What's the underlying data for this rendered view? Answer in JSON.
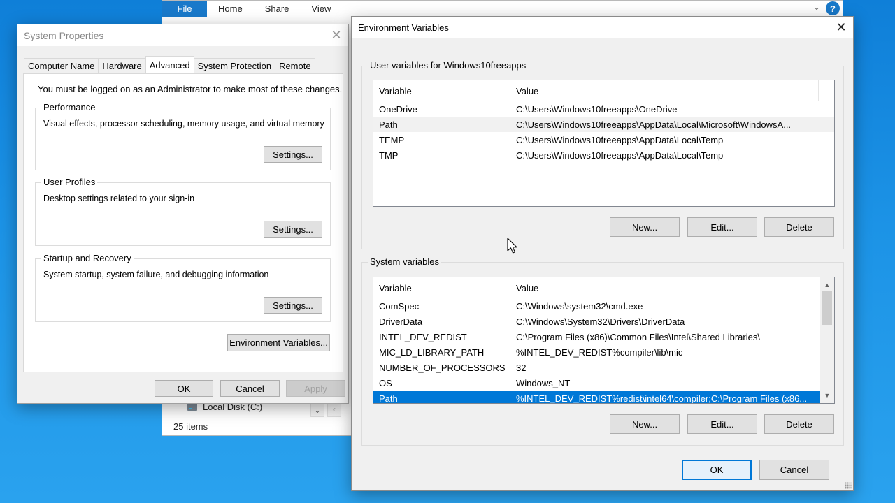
{
  "explorer": {
    "ribbon_tabs": [
      "File",
      "Home",
      "Share",
      "View"
    ],
    "help_glyph": "?",
    "nav_location": "Local Disk (C:)",
    "status": "25 items"
  },
  "system_properties": {
    "title": "System Properties",
    "tabs": [
      "Computer Name",
      "Hardware",
      "Advanced",
      "System Protection",
      "Remote"
    ],
    "active_tab": "Advanced",
    "note": "You must be logged on as an Administrator to make most of these changes.",
    "groups": {
      "performance": {
        "legend": "Performance",
        "desc": "Visual effects, processor scheduling, memory usage, and virtual memory",
        "button": "Settings..."
      },
      "user_profiles": {
        "legend": "User Profiles",
        "desc": "Desktop settings related to your sign-in",
        "button": "Settings..."
      },
      "startup": {
        "legend": "Startup and Recovery",
        "desc": "System startup, system failure, and debugging information",
        "button": "Settings..."
      }
    },
    "env_button": "Environment Variables...",
    "ok": "OK",
    "cancel": "Cancel",
    "apply": "Apply"
  },
  "env_vars": {
    "title": "Environment Variables",
    "user_group_label": "User variables for Windows10freeapps",
    "system_group_label": "System variables",
    "col_variable": "Variable",
    "col_value": "Value",
    "user_rows": [
      {
        "name": "OneDrive",
        "value": "C:\\Users\\Windows10freeapps\\OneDrive"
      },
      {
        "name": "Path",
        "value": "C:\\Users\\Windows10freeapps\\AppData\\Local\\Microsoft\\WindowsA..."
      },
      {
        "name": "TEMP",
        "value": "C:\\Users\\Windows10freeapps\\AppData\\Local\\Temp"
      },
      {
        "name": "TMP",
        "value": "C:\\Users\\Windows10freeapps\\AppData\\Local\\Temp"
      }
    ],
    "system_rows": [
      {
        "name": "ComSpec",
        "value": "C:\\Windows\\system32\\cmd.exe"
      },
      {
        "name": "DriverData",
        "value": "C:\\Windows\\System32\\Drivers\\DriverData"
      },
      {
        "name": "INTEL_DEV_REDIST",
        "value": "C:\\Program Files (x86)\\Common Files\\Intel\\Shared Libraries\\"
      },
      {
        "name": "MIC_LD_LIBRARY_PATH",
        "value": "%INTEL_DEV_REDIST%compiler\\lib\\mic"
      },
      {
        "name": "NUMBER_OF_PROCESSORS",
        "value": "32"
      },
      {
        "name": "OS",
        "value": "Windows_NT"
      },
      {
        "name": "Path",
        "value": "%INTEL_DEV_REDIST%redist\\intel64\\compiler;C:\\Program Files (x86..."
      }
    ],
    "user_buttons": {
      "new": "New...",
      "edit": "Edit...",
      "delete": "Delete"
    },
    "system_buttons": {
      "new": "New...",
      "edit": "Edit...",
      "delete": "Delete"
    },
    "ok": "OK",
    "cancel": "Cancel"
  },
  "colors": {
    "accent": "#0078d7",
    "file_tab": "#1979ca",
    "desktop": "#1c93e6"
  }
}
